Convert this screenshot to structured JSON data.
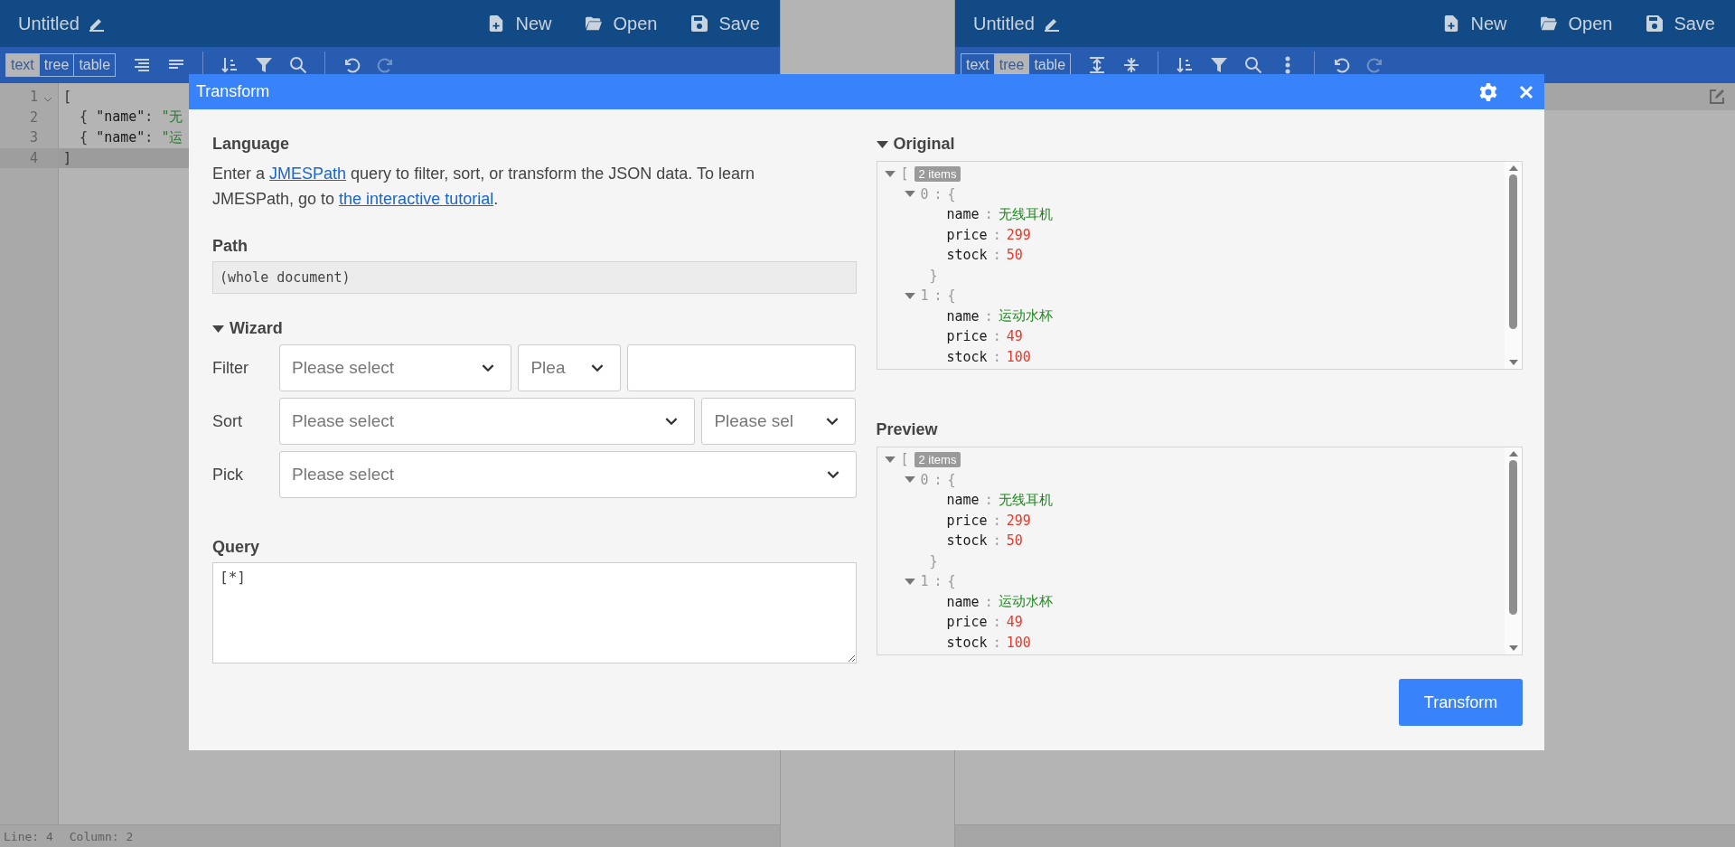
{
  "editors": [
    {
      "title": "Untitled",
      "actions": [
        {
          "kind": "new",
          "label": "New"
        },
        {
          "kind": "open",
          "label": "Open"
        },
        {
          "kind": "save",
          "label": "Save"
        }
      ],
      "modes": [
        {
          "label": "text",
          "selected": true
        },
        {
          "label": "tree",
          "selected": false
        },
        {
          "label": "table",
          "selected": false
        }
      ],
      "tools": [
        {
          "kind": "format",
          "disabled": false
        },
        {
          "kind": "compact",
          "disabled": false
        },
        {
          "kind": "sort",
          "disabled": false
        },
        {
          "kind": "filter",
          "disabled": false
        },
        {
          "kind": "search",
          "disabled": false
        },
        {
          "kind": "undo",
          "disabled": false
        },
        {
          "kind": "redo",
          "disabled": true
        }
      ],
      "lines": [
        {
          "number": "1",
          "foldable": true,
          "current": false,
          "tokens": [
            {
              "kind": "punct",
              "text": "["
            }
          ]
        },
        {
          "number": "2",
          "foldable": false,
          "current": false,
          "tokens": [
            {
              "kind": "punct",
              "text": "  { "
            },
            {
              "kind": "key",
              "text": "\"name\""
            },
            {
              "kind": "punct",
              "text": ": "
            },
            {
              "kind": "string",
              "text": "\"无"
            }
          ]
        },
        {
          "number": "3",
          "foldable": false,
          "current": false,
          "tokens": [
            {
              "kind": "punct",
              "text": "  { "
            },
            {
              "kind": "key",
              "text": "\"name\""
            },
            {
              "kind": "punct",
              "text": ": "
            },
            {
              "kind": "string",
              "text": "\"运"
            }
          ]
        },
        {
          "number": "4",
          "foldable": false,
          "current": true,
          "tokens": [
            {
              "kind": "punct",
              "text": "]"
            }
          ]
        }
      ],
      "status": [
        {
          "text": "Line: 4"
        },
        {
          "text": "Column: 2"
        }
      ]
    },
    {
      "title": "Untitled",
      "actions": [
        {
          "kind": "new",
          "label": "New"
        },
        {
          "kind": "open",
          "label": "Open"
        },
        {
          "kind": "save",
          "label": "Save"
        }
      ],
      "modes": [
        {
          "label": "text",
          "selected": false
        },
        {
          "label": "tree",
          "selected": true
        },
        {
          "label": "table",
          "selected": false
        }
      ],
      "tools": [
        {
          "kind": "expand",
          "disabled": false
        },
        {
          "kind": "collapse",
          "disabled": false
        },
        {
          "kind": "sort",
          "disabled": false
        },
        {
          "kind": "filter",
          "disabled": false
        },
        {
          "kind": "search",
          "disabled": false
        },
        {
          "kind": "more",
          "disabled": false
        },
        {
          "kind": "undo",
          "disabled": false
        },
        {
          "kind": "redo",
          "disabled": true
        }
      ]
    }
  ],
  "dialog": {
    "title": "Transform",
    "language": {
      "heading": "Language",
      "description": [
        {
          "text": "Enter a ",
          "link": false
        },
        {
          "text": "JMESPath",
          "link": true
        },
        {
          "text": " query to filter, sort, or transform the JSON data. To learn JMESPath, go to ",
          "link": false
        },
        {
          "text": "the interactive tutorial",
          "link": true
        },
        {
          "text": ".",
          "link": false
        }
      ]
    },
    "path": {
      "heading": "Path",
      "value": "(whole document)"
    },
    "wizard": {
      "heading": "Wizard",
      "expanded": true,
      "rows": [
        {
          "label": "Filter",
          "controls": [
            {
              "kind": "select",
              "placeholder": "Please select"
            },
            {
              "kind": "select",
              "placeholder": "Plea"
            },
            {
              "kind": "input"
            }
          ]
        },
        {
          "label": "Sort",
          "controls": [
            {
              "kind": "select",
              "placeholder": "Please select"
            },
            {
              "kind": "select",
              "placeholder": "Please sel"
            }
          ]
        },
        {
          "label": "Pick",
          "controls": [
            {
              "kind": "select",
              "placeholder": "Please select"
            }
          ]
        }
      ]
    },
    "query": {
      "heading": "Query",
      "value": "[*]"
    },
    "panels": [
      {
        "heading": "Original",
        "collapsible": true,
        "expanded": true,
        "tree": {
          "bracket": "[",
          "badge": "2 items",
          "expanded": true,
          "children": [
            {
              "index": "0",
              "separator": ":",
              "bracket": "{",
              "expanded": true,
              "fields": [
                {
                  "key": "name",
                  "separator": ":",
                  "value": "无线耳机",
                  "kind": "string"
                },
                {
                  "key": "price",
                  "separator": ":",
                  "value": "299",
                  "kind": "number"
                },
                {
                  "key": "stock",
                  "separator": ":",
                  "value": "50",
                  "kind": "number"
                }
              ],
              "closing": "}"
            },
            {
              "index": "1",
              "separator": ":",
              "bracket": "{",
              "expanded": true,
              "fields": [
                {
                  "key": "name",
                  "separator": ":",
                  "value": "运动水杯",
                  "kind": "string"
                },
                {
                  "key": "price",
                  "separator": ":",
                  "value": "49",
                  "kind": "number"
                },
                {
                  "key": "stock",
                  "separator": ":",
                  "value": "100",
                  "kind": "number"
                }
              ]
            }
          ]
        }
      },
      {
        "heading": "Preview",
        "collapsible": false,
        "tree": {
          "bracket": "[",
          "badge": "2 items",
          "expanded": true,
          "children": [
            {
              "index": "0",
              "separator": ":",
              "bracket": "{",
              "expanded": true,
              "fields": [
                {
                  "key": "name",
                  "separator": ":",
                  "value": "无线耳机",
                  "kind": "string"
                },
                {
                  "key": "price",
                  "separator": ":",
                  "value": "299",
                  "kind": "number"
                },
                {
                  "key": "stock",
                  "separator": ":",
                  "value": "50",
                  "kind": "number"
                }
              ],
              "closing": "}"
            },
            {
              "index": "1",
              "separator": ":",
              "bracket": "{",
              "expanded": true,
              "fields": [
                {
                  "key": "name",
                  "separator": ":",
                  "value": "运动水杯",
                  "kind": "string"
                },
                {
                  "key": "price",
                  "separator": ":",
                  "value": "49",
                  "kind": "number"
                },
                {
                  "key": "stock",
                  "separator": ":",
                  "value": "100",
                  "kind": "number"
                }
              ]
            }
          ]
        }
      }
    ],
    "button": "Transform"
  }
}
